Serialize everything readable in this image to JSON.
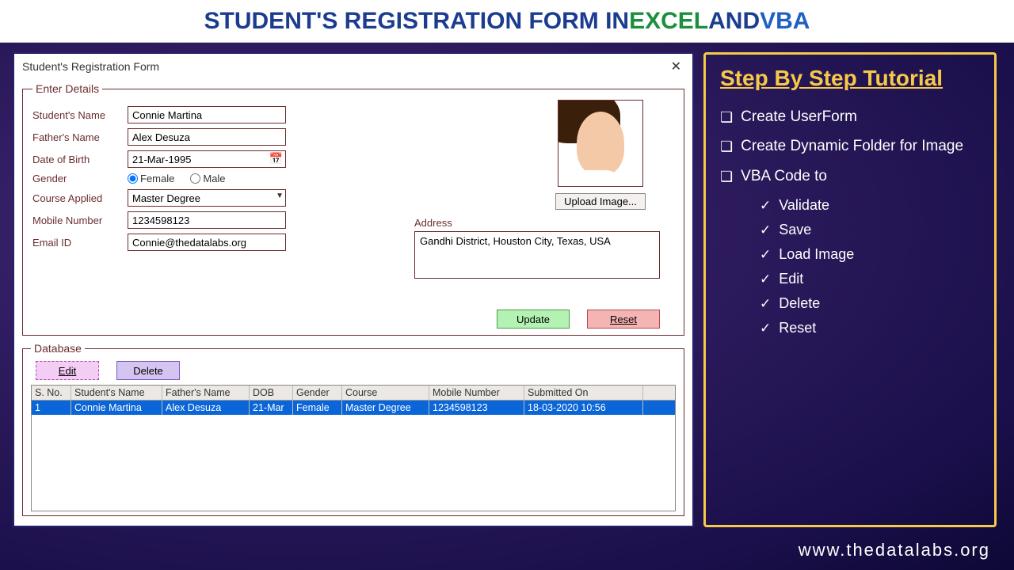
{
  "header": {
    "part1": "STUDENT'S REGISTRATION FORM IN ",
    "part2": "EXCEL",
    "part3": " AND ",
    "part4": "VBA"
  },
  "window": {
    "title": "Student's Registration Form"
  },
  "form": {
    "legend": "Enter Details",
    "labels": {
      "student_name": "Student's Name",
      "father_name": "Father's Name",
      "dob": "Date of Birth",
      "gender": "Gender",
      "course": "Course Applied",
      "mobile": "Mobile Number",
      "email": "Email ID",
      "address": "Address"
    },
    "values": {
      "student_name": "Connie Martina",
      "father_name": "Alex Desuza",
      "dob": "21-Mar-1995",
      "gender_female": "Female",
      "gender_male": "Male",
      "course": "Master Degree",
      "mobile": "1234598123",
      "email": "Connie@thedatalabs.org",
      "address": "Gandhi District, Houston City, Texas, USA"
    },
    "buttons": {
      "upload": "Upload Image...",
      "update": "Update",
      "reset": "Reset"
    }
  },
  "database": {
    "legend": "Database",
    "buttons": {
      "edit": "Edit",
      "delete": "Delete"
    },
    "headers": {
      "sno": "S. No.",
      "name": "Student's Name",
      "fname": "Father's Name",
      "dob": "DOB",
      "gender": "Gender",
      "course": "Course",
      "mobile": "Mobile Number",
      "submitted": "Submitted On"
    },
    "rows": [
      {
        "sno": "1",
        "name": "Connie Martina",
        "fname": "Alex Desuza",
        "dob": "21-Mar",
        "gender": "Female",
        "course": "Master Degree",
        "mobile": "1234598123",
        "submitted": "18-03-2020 10:56"
      }
    ]
  },
  "sidebar": {
    "title": "Step By Step Tutorial",
    "items": [
      "Create UserForm",
      "Create Dynamic Folder for Image",
      "VBA Code to"
    ],
    "sub": [
      "Validate",
      "Save",
      "Load Image",
      "Edit",
      "Delete",
      "Reset"
    ]
  },
  "footer_url": "www.thedatalabs.org"
}
